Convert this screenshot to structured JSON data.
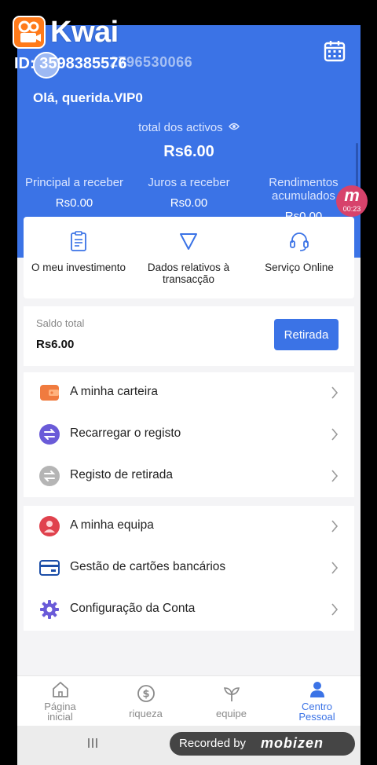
{
  "watermark": {
    "app_name": "Kwai",
    "id_text": "ID: 3598385576"
  },
  "header": {
    "id_line": "2796530066",
    "greeting": "Olá, querida.VIP0",
    "total_label": "total dos activos",
    "total_value": "Rs6.00",
    "stats": [
      {
        "label": "Principal a receber",
        "value": "Rs0.00"
      },
      {
        "label": "Juros a receber",
        "value": "Rs0.00"
      },
      {
        "label": "Rendimentos acumulados",
        "value": "Rs0.00"
      }
    ]
  },
  "quick_actions": [
    {
      "label": "O meu investimento",
      "icon": "clipboard-icon"
    },
    {
      "label": "Dados relativos à transacção",
      "icon": "triangle-icon"
    },
    {
      "label": "Serviço Online",
      "icon": "headset-icon"
    }
  ],
  "balance": {
    "label": "Saldo total",
    "value": "Rs6.00",
    "button": "Retirada"
  },
  "menu_group_1": [
    {
      "label": "A minha carteira",
      "icon": "wallet-icon"
    },
    {
      "label": "Recarregar o registo",
      "icon": "recharge-icon"
    },
    {
      "label": "Registo de retirada",
      "icon": "withdraw-icon"
    }
  ],
  "menu_group_2": [
    {
      "label": "A minha equipa",
      "icon": "team-icon"
    },
    {
      "label": "Gestão de cartões bancários",
      "icon": "bank-card-icon"
    },
    {
      "label": "Configuração da Conta",
      "icon": "settings-icon"
    }
  ],
  "bottom_nav": [
    {
      "label": "Página inicial",
      "icon": "home-icon"
    },
    {
      "label": "riqueza",
      "icon": "dollar-icon"
    },
    {
      "label": "equipe",
      "icon": "sprout-icon"
    },
    {
      "label": "Centro Pessoal",
      "icon": "person-icon",
      "active": true
    }
  ],
  "overlay": {
    "recorded_label": "Recorded by",
    "recorder_name": "mobizen",
    "timer": "00:23"
  },
  "colors": {
    "primary": "#3b73e6",
    "background": "#f4f4f6"
  }
}
